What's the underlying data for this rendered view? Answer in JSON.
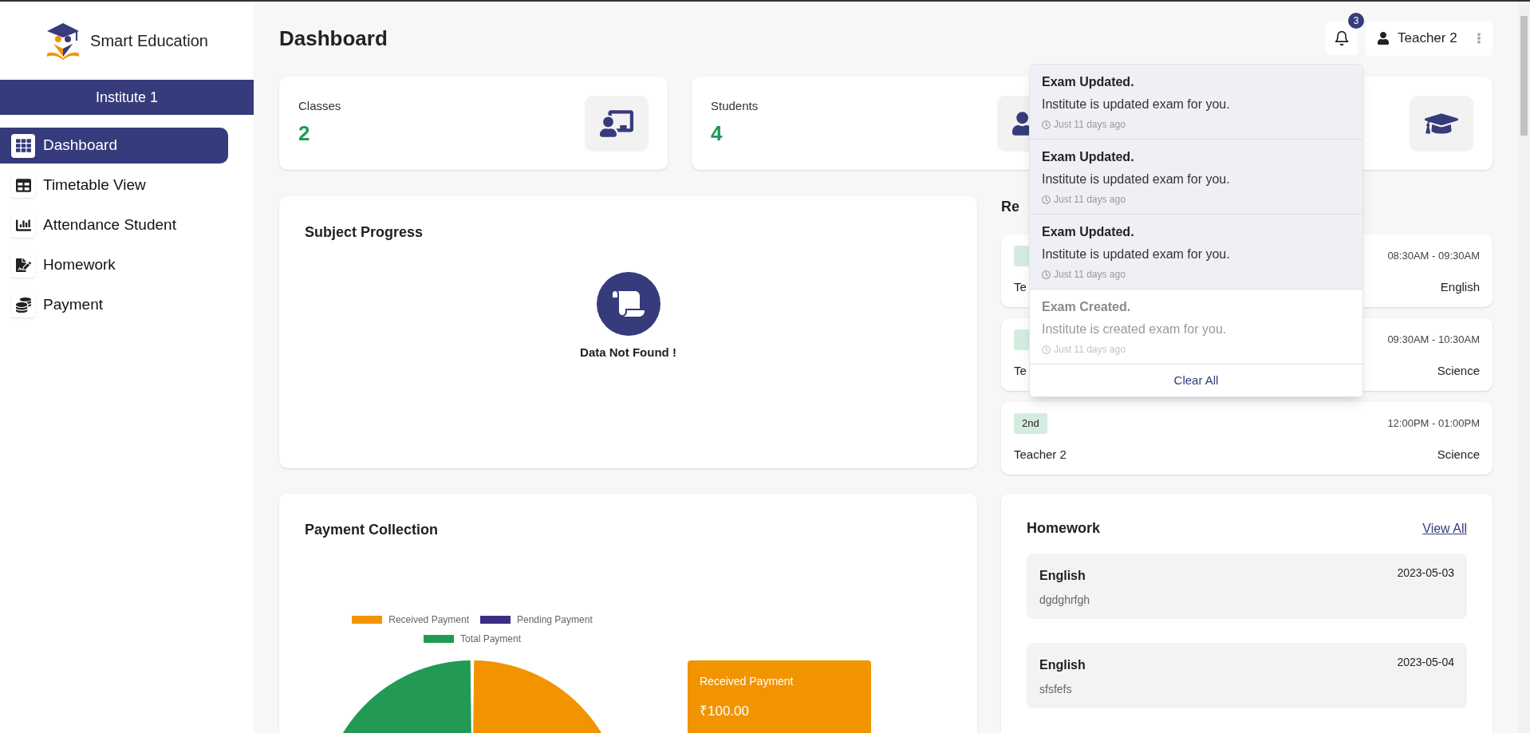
{
  "brand": {
    "name": "Smart Education"
  },
  "institute": "Institute 1",
  "sidebar": {
    "items": [
      {
        "label": "Dashboard",
        "selected": true
      },
      {
        "label": "Timetable View",
        "selected": false
      },
      {
        "label": "Attendance Student",
        "selected": false
      },
      {
        "label": "Homework",
        "selected": false
      },
      {
        "label": "Payment",
        "selected": false
      }
    ]
  },
  "page_title": "Dashboard",
  "header": {
    "notification_count": "3",
    "user_name": "Teacher 2"
  },
  "notifications": {
    "items": [
      {
        "title": "Exam Updated.",
        "message": "Institute is updated exam for you.",
        "time": "Just 11 days ago",
        "unread": true
      },
      {
        "title": "Exam Updated.",
        "message": "Institute is updated exam for you.",
        "time": "Just 11 days ago",
        "unread": true
      },
      {
        "title": "Exam Updated.",
        "message": "Institute is updated exam for you.",
        "time": "Just 11 days ago",
        "unread": true
      },
      {
        "title": "Exam Created.",
        "message": "Institute is created exam for you.",
        "time": "Just 11 days ago",
        "unread": false
      }
    ],
    "clear_label": "Clear All"
  },
  "stats": [
    {
      "label": "Classes",
      "value": "2"
    },
    {
      "label": "Students",
      "value": "4"
    }
  ],
  "subject_progress": {
    "title": "Subject Progress",
    "empty_message": "Data Not Found !"
  },
  "lectures": {
    "title": "Re",
    "items": [
      {
        "time": "08:30AM - 09:30AM",
        "teacher": "Te",
        "subject": "English"
      },
      {
        "time": "09:30AM - 10:30AM",
        "teacher": "Te",
        "subject": "Science"
      },
      {
        "badge": "2nd",
        "time": "12:00PM - 01:00PM",
        "teacher": "Teacher 2",
        "subject": "Science"
      }
    ]
  },
  "payment": {
    "title": "Payment Collection",
    "legend": [
      {
        "label": "Received Payment",
        "color": "#f29400"
      },
      {
        "label": "Pending Payment",
        "color": "#3b2f85"
      },
      {
        "label": "Total Payment",
        "color": "#229a55"
      }
    ],
    "summary": {
      "label": "Received Payment",
      "amount": "₹100.00"
    }
  },
  "homework": {
    "title": "Homework",
    "view_all": "View All",
    "items": [
      {
        "subject": "English",
        "date": "2023-05-03",
        "description": "dgdghrfgh"
      },
      {
        "subject": "English",
        "date": "2023-05-04",
        "description": "sfsfefs"
      }
    ]
  }
}
